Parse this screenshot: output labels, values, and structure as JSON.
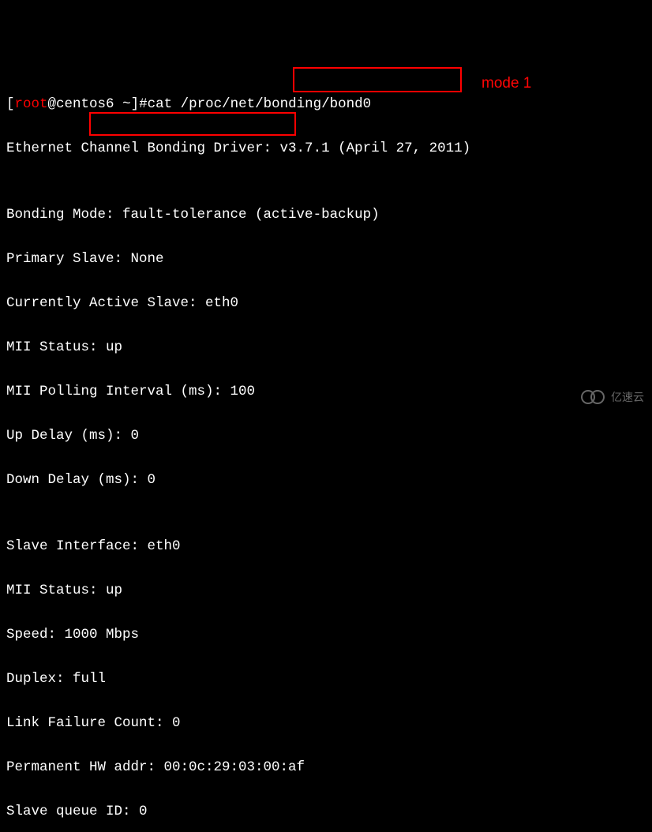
{
  "prompt": {
    "open": "[",
    "user": "root",
    "at": "@",
    "host": "centos6",
    "path": " ~",
    "close": "]",
    "hash": "#"
  },
  "command": "cat /proc/net/bonding/bond0",
  "output": {
    "line1": "Ethernet Channel Bonding Driver: v3.7.1 (April 27, 2011)",
    "line2": "",
    "line3": "Bonding Mode: fault-tolerance (active-backup)",
    "line4": "Primary Slave: None",
    "line5": "Currently Active Slave: eth0",
    "line6": "MII Status: up",
    "line7": "MII Polling Interval (ms): 100",
    "line8": "Up Delay (ms): 0",
    "line9": "Down Delay (ms): 0",
    "line10": "",
    "line11": "Slave Interface: eth0",
    "line12": "MII Status: up",
    "line13": "Speed: 1000 Mbps",
    "line14": "Duplex: full",
    "line15": "Link Failure Count: 0",
    "line16": "Permanent HW addr: 00:0c:29:03:00:af",
    "line17": "Slave queue ID: 0"
  },
  "annotation": "mode 1",
  "watermark": "亿速云"
}
